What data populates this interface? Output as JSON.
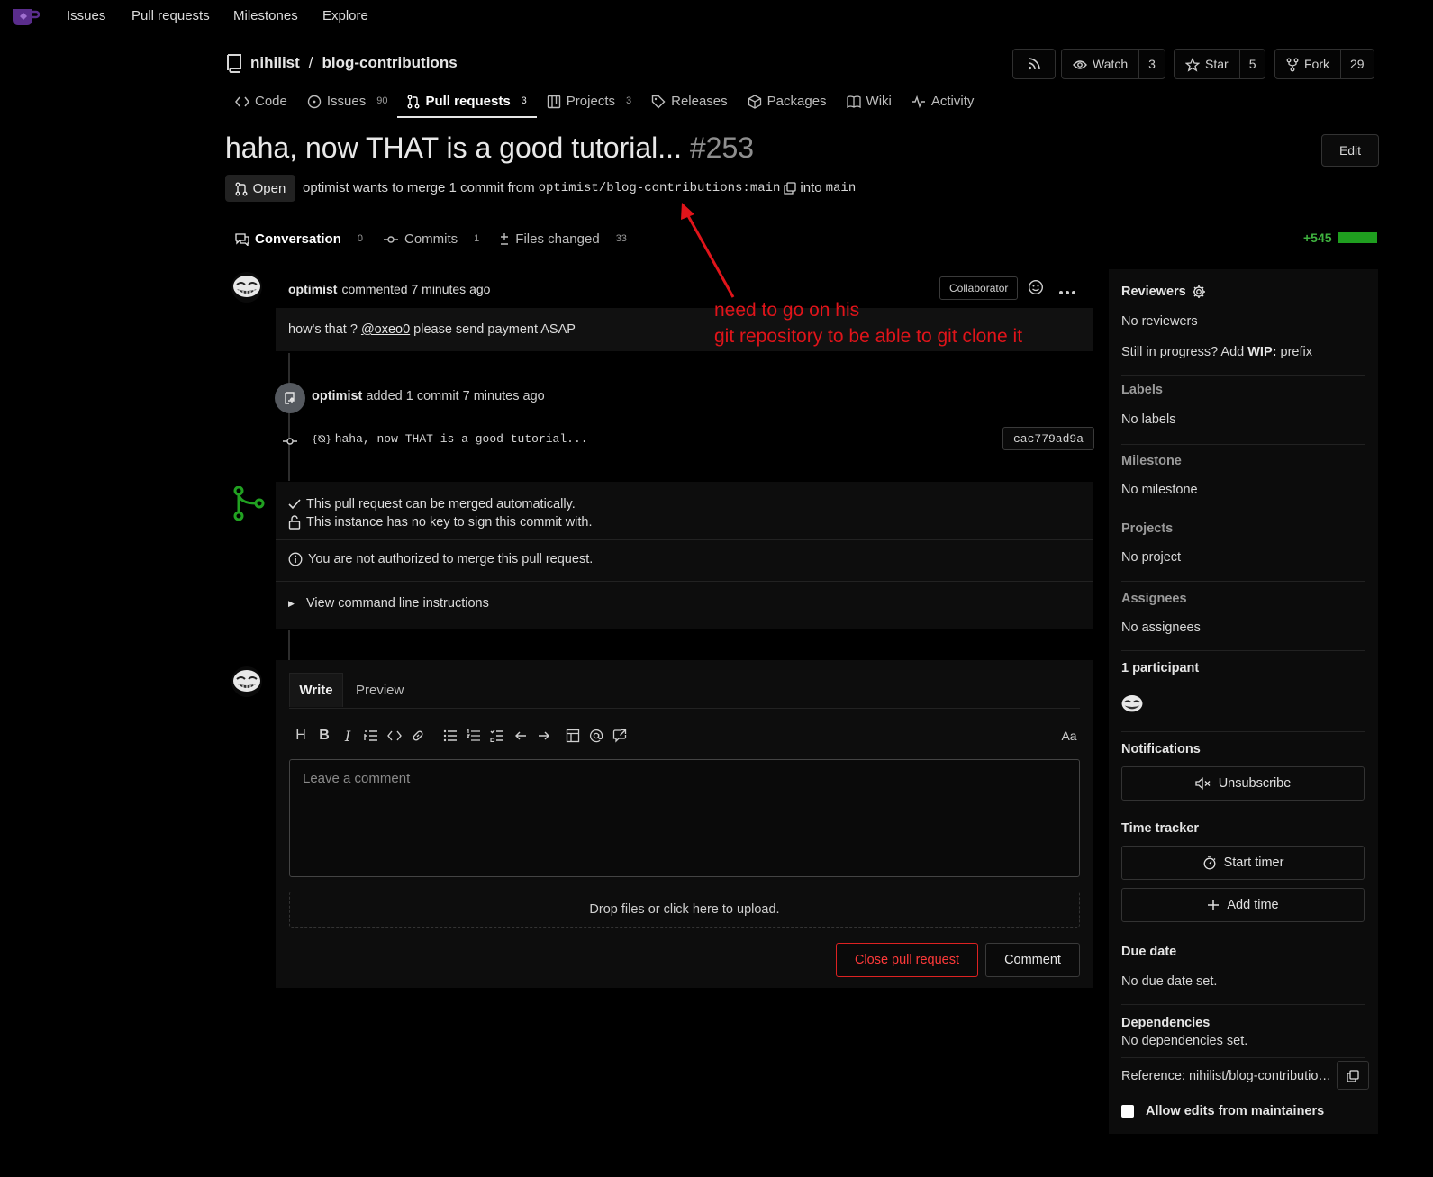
{
  "nav": {
    "links": [
      "Issues",
      "Pull requests",
      "Milestones",
      "Explore"
    ]
  },
  "repo": {
    "owner": "nihilist",
    "sep": "/",
    "name": "blog-contributions"
  },
  "repo_buttons": {
    "watch": "Watch",
    "watch_count": "3",
    "star": "Star",
    "star_count": "5",
    "fork": "Fork",
    "fork_count": "29"
  },
  "repo_tabs": [
    {
      "label": "Code",
      "count": ""
    },
    {
      "label": "Issues",
      "count": "90"
    },
    {
      "label": "Pull requests",
      "count": "3"
    },
    {
      "label": "Projects",
      "count": "3"
    },
    {
      "label": "Releases",
      "count": ""
    },
    {
      "label": "Packages",
      "count": ""
    },
    {
      "label": "Wiki",
      "count": ""
    },
    {
      "label": "Activity",
      "count": ""
    }
  ],
  "pr": {
    "title": "haha, now THAT is a good tutorial...",
    "number": "#253",
    "edit": "Edit",
    "status": "Open",
    "merge_text": "optimist wants to merge 1 commit from",
    "source_branch": "optimist/blog-contributions:main",
    "into": "into",
    "target_branch": "main"
  },
  "pr_tabs": [
    {
      "label": "Conversation",
      "count": "0"
    },
    {
      "label": "Commits",
      "count": "1"
    },
    {
      "label": "Files changed",
      "count": "33"
    }
  ],
  "diffstat": "+545",
  "comment": {
    "author": "optimist",
    "action": "commented 7 minutes ago",
    "role": "Collaborator",
    "body_before": "how's that ?",
    "mention": "@oxeo0",
    "body_after": "please send payment ASAP"
  },
  "commit_event": {
    "author": "optimist",
    "text": "added 1 commit 7 minutes ago",
    "message": "haha, now THAT is a good tutorial...",
    "sha": "cac779ad9a"
  },
  "merge": {
    "auto": "This pull request can be merged automatically.",
    "nokey": "This instance has no key to sign this commit with.",
    "unauth": "You are not authorized to merge this pull request.",
    "cli": "View command line instructions"
  },
  "editor": {
    "write": "Write",
    "preview": "Preview",
    "placeholder": "Leave a comment",
    "dropzone": "Drop files or click here to upload.",
    "close_btn": "Close pull request",
    "comment_btn": "Comment",
    "font_toggle": "Aa"
  },
  "sidebar": {
    "reviewers_h": "Reviewers",
    "reviewers": "No reviewers",
    "wip_before": "Still in progress? Add",
    "wip_bold": "WIP:",
    "wip_after": "prefix",
    "labels_h": "Labels",
    "labels": "No labels",
    "milestone_h": "Milestone",
    "milestone": "No milestone",
    "projects_h": "Projects",
    "projects": "No project",
    "assignees_h": "Assignees",
    "assignees": "No assignees",
    "participants_h": "1 participant",
    "notifications_h": "Notifications",
    "unsubscribe": "Unsubscribe",
    "time_h": "Time tracker",
    "start_timer": "Start timer",
    "add_time": "Add time",
    "due_h": "Due date",
    "due": "No due date set.",
    "deps_h": "Dependencies",
    "deps": "No dependencies set.",
    "reference": "Reference: nihilist/blog-contributio…",
    "allow_edits": "Allow edits from maintainers"
  },
  "annotation": {
    "line1": "need to go on his",
    "line2": "git repository to be able to git clone it"
  },
  "colors": {
    "accent_red": "#e0141a",
    "merge_green": "#1f9e1f",
    "danger": "#ff3a3a"
  }
}
